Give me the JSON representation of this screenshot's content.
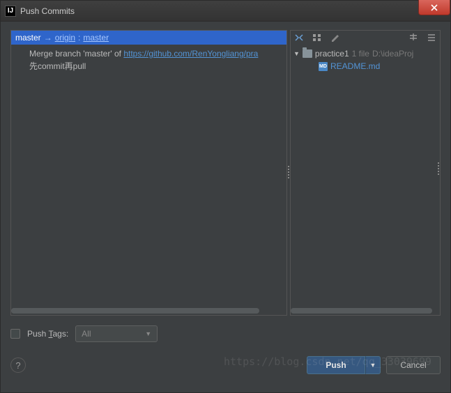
{
  "title": "Push Commits",
  "branch": {
    "local": "master",
    "remote": "origin",
    "target": "master"
  },
  "commits": [
    {
      "prefix": "Merge branch 'master' of ",
      "url_text": "https://github.com/RenYongliang/pra"
    },
    {
      "prefix": "先commit再pull",
      "url_text": ""
    }
  ],
  "file_tree": {
    "root_name": "practice1",
    "file_count": "1 file",
    "path": "D:\\ideaProj",
    "children": [
      {
        "name": "README.md",
        "icon_label": "MD"
      }
    ]
  },
  "push_tags": {
    "label_pre": "Push ",
    "label_mn": "T",
    "label_post": "ags:",
    "selected": "All"
  },
  "buttons": {
    "push": "Push",
    "cancel": "Cancel"
  },
  "watermark": "https://blog.csdn.net/qq_33039699"
}
